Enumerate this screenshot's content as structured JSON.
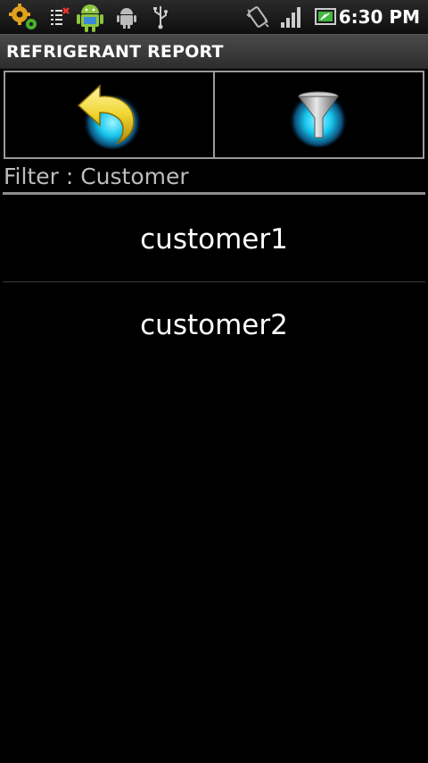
{
  "status_bar": {
    "time": "6:30 PM",
    "left_icons": [
      "gears-notification-icon",
      "checklist-notification-icon",
      "android-robot-icon",
      "android-debug-icon",
      "usb-icon"
    ],
    "right_icons": [
      "vibrate-icon",
      "signal-strength-icon",
      "battery-icon"
    ]
  },
  "app": {
    "title": "REFRIGERANT REPORT"
  },
  "toolbar": {
    "back_icon": "back-arrow-icon",
    "filter_icon": "funnel-filter-icon"
  },
  "filter": {
    "label": "Filter : Customer"
  },
  "customers": [
    {
      "name": "customer1"
    },
    {
      "name": "customer2"
    }
  ],
  "colors": {
    "background": "#000000",
    "accent_cyan": "#18c8f0",
    "arrow_yellow": "#f0d630",
    "border_gray": "#9a9a9a"
  }
}
